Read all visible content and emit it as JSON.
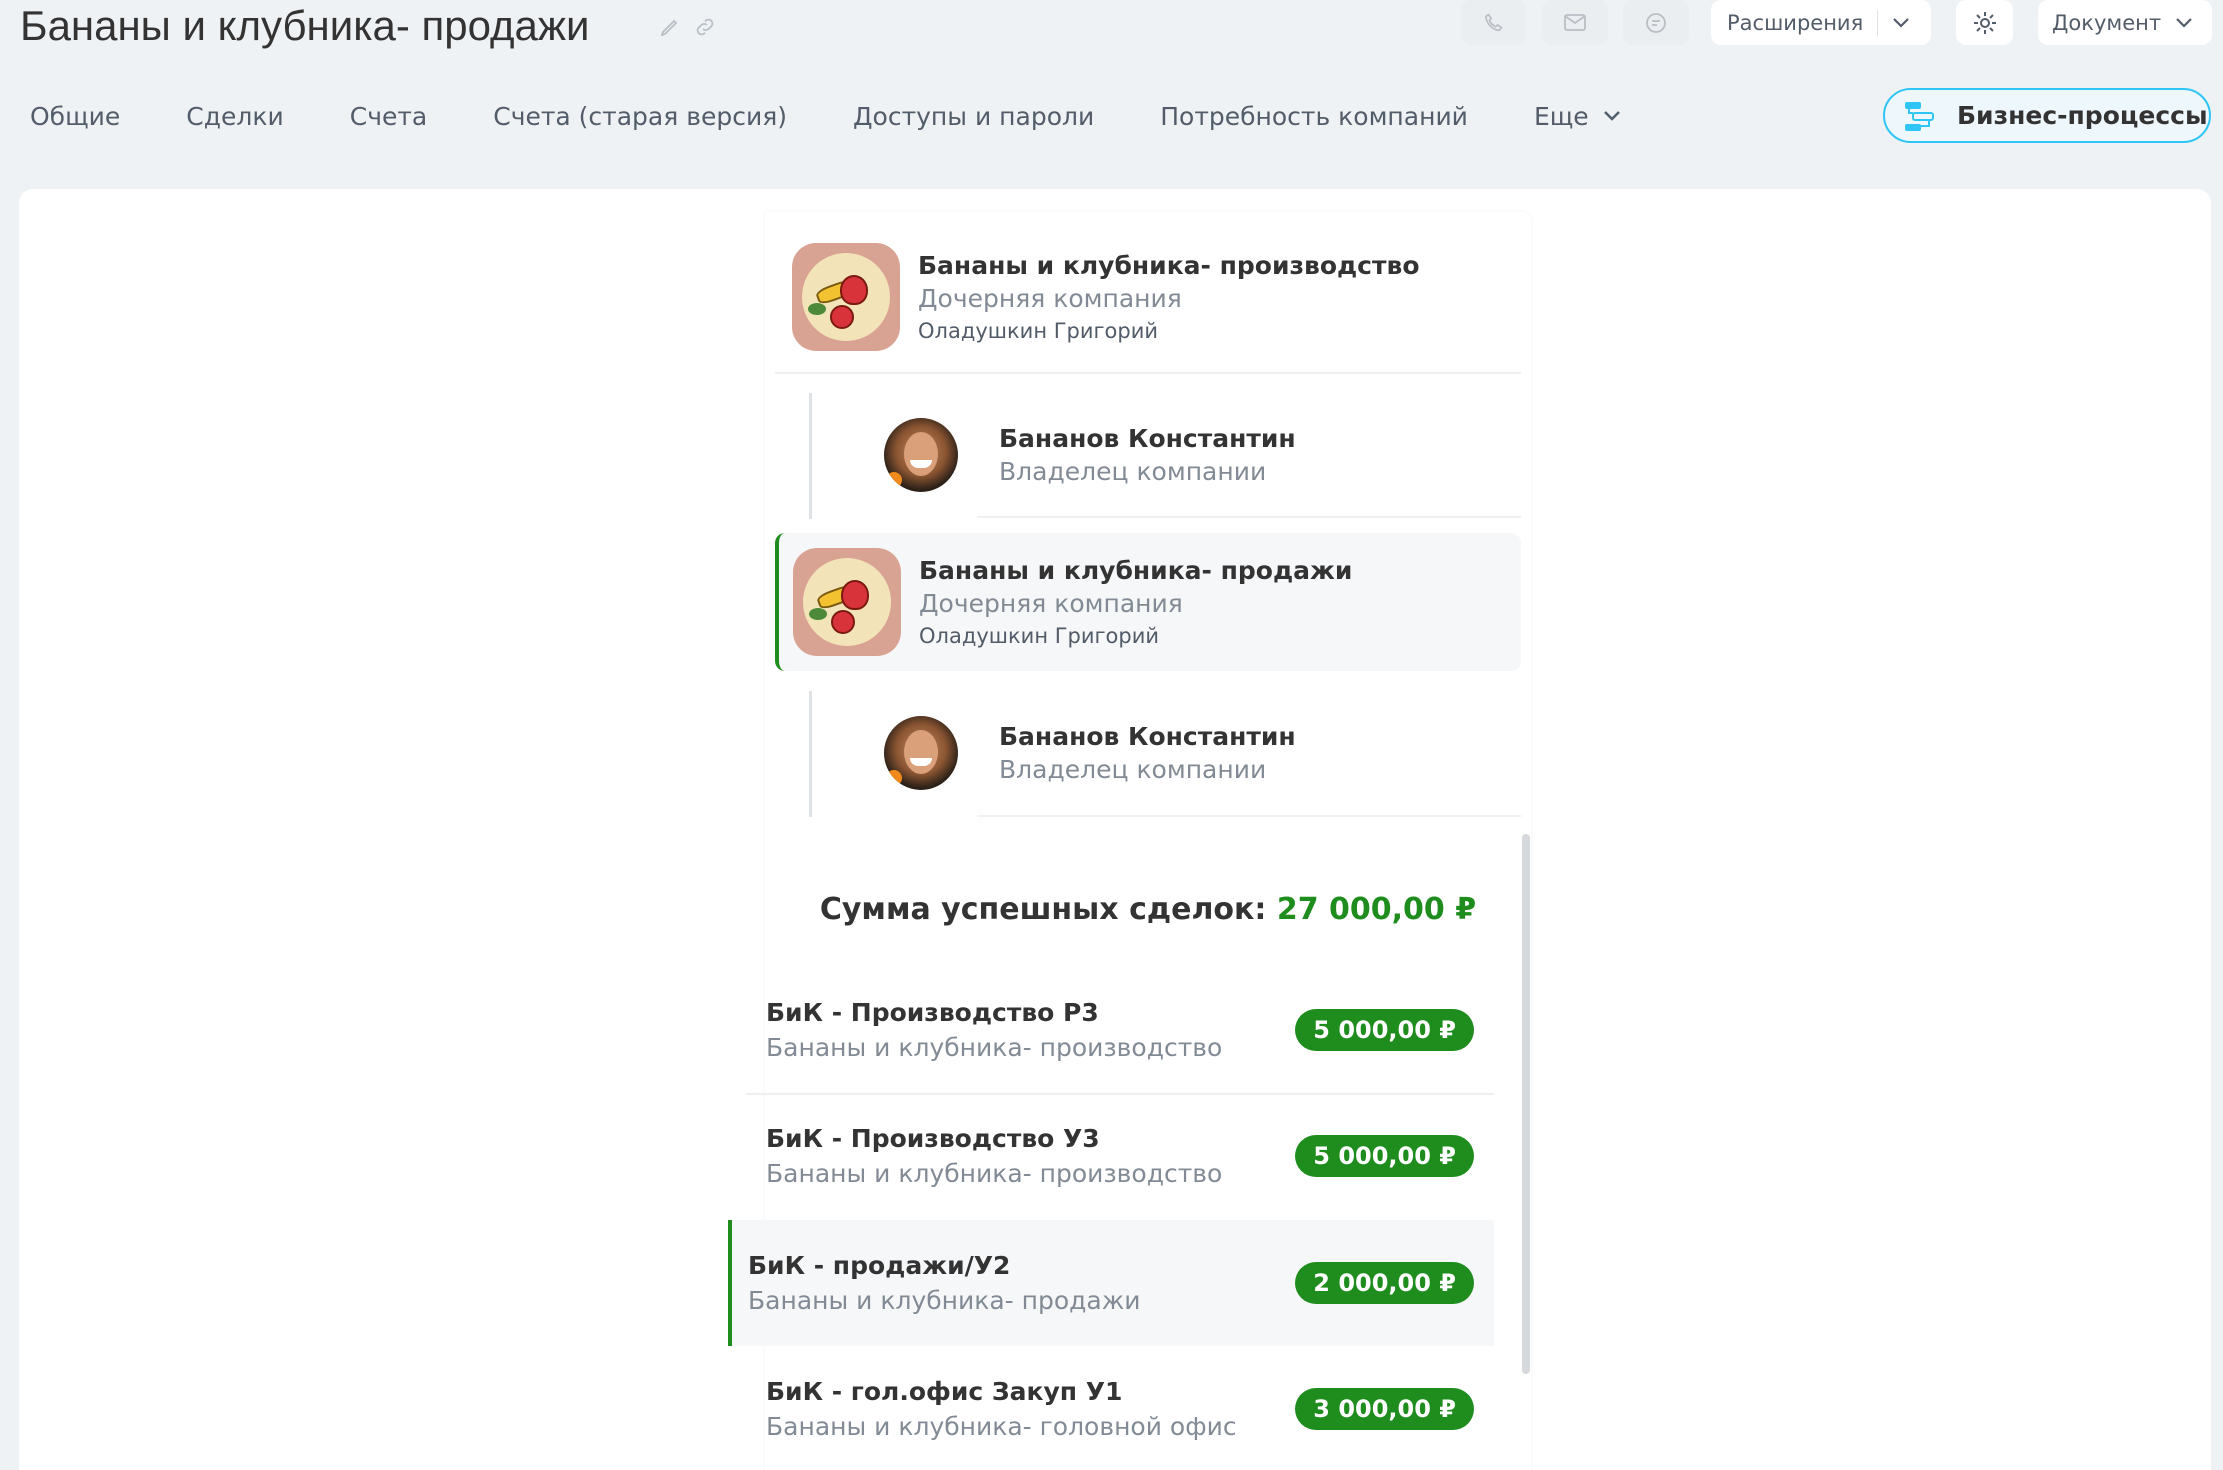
{
  "header": {
    "title": "Бананы и клубника- продажи",
    "edit_icon": "pencil-icon",
    "link_icon": "link-icon",
    "call_icon": "phone-icon",
    "mail_icon": "envelope-icon",
    "chat_icon": "chat-icon",
    "extensions_label": "Расширения",
    "settings_icon": "gear-icon",
    "document_label": "Документ"
  },
  "tabs": [
    {
      "label": "Общие"
    },
    {
      "label": "Сделки"
    },
    {
      "label": "Счета"
    },
    {
      "label": "Счета (старая версия)"
    },
    {
      "label": "Доступы и пароли"
    },
    {
      "label": "Потребность компаний"
    },
    {
      "label": "Еще"
    }
  ],
  "bp_button": {
    "label": "Бизнес-процессы",
    "icon": "workflow-icon"
  },
  "tree": [
    {
      "type": "company",
      "name": "Бананы и клубника- производство",
      "role": "Дочерняя компания",
      "responsible": "Оладушкин Григорий",
      "active": false
    },
    {
      "type": "person",
      "name": "Бананов Константин",
      "role": "Владелец компании"
    },
    {
      "type": "company",
      "name": "Бананы и клубника- продажи",
      "role": "Дочерняя компания",
      "responsible": "Оладушкин Григорий",
      "active": true
    },
    {
      "type": "person",
      "name": "Бананов Константин",
      "role": "Владелец компании"
    }
  ],
  "deals_summary": {
    "label": "Сумма успешных сделок:",
    "value": "27 000,00 ₽"
  },
  "deals": [
    {
      "name": "БиК - Производство Р3",
      "company": "Бананы и клубника- производство",
      "amount": "5 000,00 ₽",
      "active": false
    },
    {
      "name": "БиК - Производство У3",
      "company": "Бананы и клубника- производство",
      "amount": "5 000,00 ₽",
      "active": false
    },
    {
      "name": "БиК - продажи/У2",
      "company": "Бананы и клубника- продажи",
      "amount": "2 000,00 ₽",
      "active": true
    },
    {
      "name": "БиК - гол.офис Закуп У1",
      "company": "Бананы и клубника- головной офис",
      "amount": "3 000,00 ₽",
      "active": false
    }
  ],
  "colors": {
    "accent_green": "#1e8d1e",
    "bp_border": "#2fc6f6",
    "background": "#eef2f4"
  }
}
